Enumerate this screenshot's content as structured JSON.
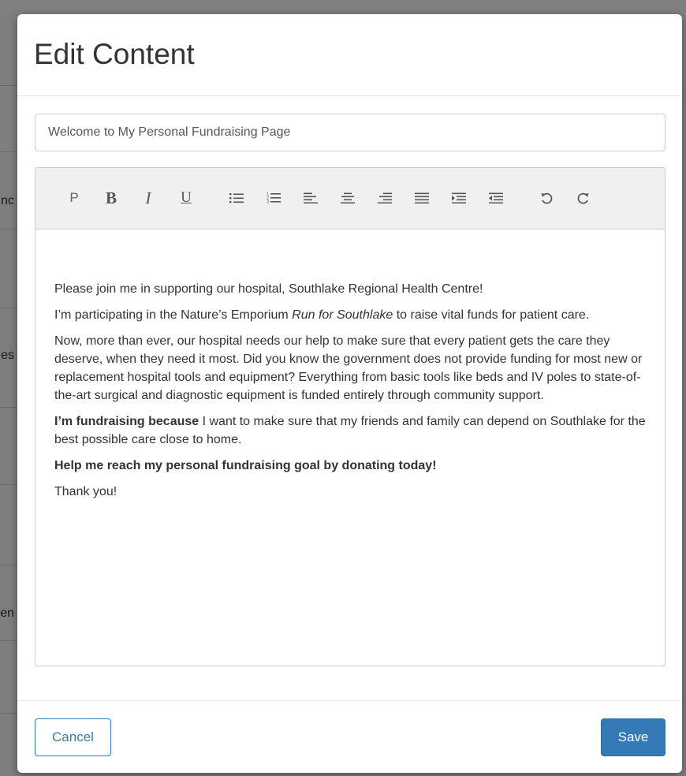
{
  "background": {
    "fragments": [
      "nc",
      "es",
      "en"
    ]
  },
  "modal": {
    "title": "Edit Content",
    "title_input_value": "Welcome to My Personal Fundraising Page",
    "toolbar": {
      "paragraph_label": "P",
      "bold_label": "B",
      "italic_label": "I",
      "underline_label": "U",
      "icons": [
        "unordered-list-icon",
        "ordered-list-icon",
        "align-left-icon",
        "align-center-icon",
        "align-right-icon",
        "align-justify-icon",
        "indent-icon",
        "outdent-icon",
        "undo-icon",
        "redo-icon"
      ]
    },
    "content": {
      "p1": "Please join me in supporting our hospital, Southlake Regional Health Centre!",
      "p2_before": " I’m participating in the Nature’s Emporium ",
      "p2_italic": "Run for Southlake",
      "p2_after": " to raise vital funds for patient care.",
      "p3": "Now, more than ever, our hospital needs our help to make sure that every patient gets the care they deserve, when they need it most. Did you know the government does not provide funding for most new or replacement hospital tools and equipment? Everything from basic tools like beds and IV poles to state-of-the-art surgical and diagnostic equipment is funded entirely through community support.",
      "p4_bold": "I’m fundraising because",
      "p4_rest": " I want to make sure that my friends and family can depend on Southlake for the best possible care close to home.",
      "p5_bold": "Help me reach my personal fundraising goal by donating today!",
      "p6": "Thank you!"
    },
    "footer": {
      "cancel_label": "Cancel",
      "save_label": "Save"
    },
    "colors": {
      "primary": "#337ab7",
      "toolbar_bg": "#f0f0f0",
      "text": "#333333"
    }
  }
}
